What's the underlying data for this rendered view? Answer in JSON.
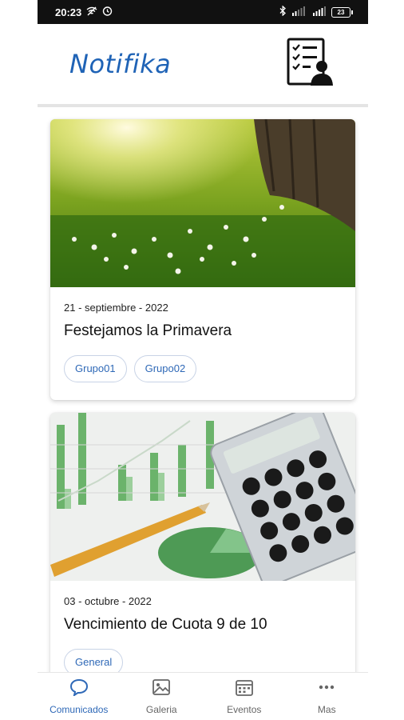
{
  "status_bar": {
    "time": "20:23",
    "battery": "23",
    "icons": [
      "wifi-off-icon",
      "alarm-icon",
      "bluetooth-icon",
      "signal-icon",
      "battery-icon"
    ]
  },
  "header": {
    "brand": "Notifika",
    "brand_color": "#1f63b6",
    "action_icon": "checklist-user-icon"
  },
  "feed": {
    "items": [
      {
        "date": "21 - septiembre - 2022",
        "title": "Festejamos la Primavera",
        "image_icon": "spring-meadow-photo",
        "tags": [
          "Grupo01",
          "Grupo02"
        ]
      },
      {
        "date": "03 - octubre - 2022",
        "title": "Vencimiento de Cuota 9 de 10",
        "image_icon": "finance-calculator-photo",
        "tags": [
          "General"
        ]
      }
    ]
  },
  "bottom_nav": {
    "items": [
      {
        "label": "Comunicados",
        "icon": "chat-bubble-icon",
        "active": true
      },
      {
        "label": "Galeria",
        "icon": "gallery-icon",
        "active": false
      },
      {
        "label": "Eventos",
        "icon": "calendar-icon",
        "active": false
      },
      {
        "label": "Mas",
        "icon": "more-dots-icon",
        "active": false
      }
    ],
    "active_color": "#2f69b7"
  }
}
